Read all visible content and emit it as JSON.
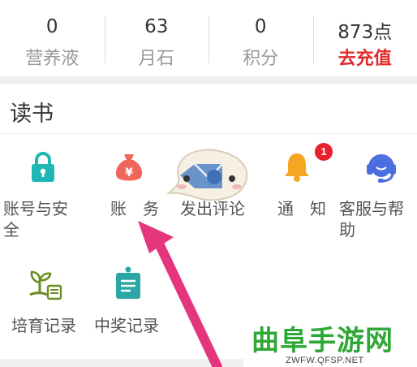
{
  "stats": [
    {
      "value": "0",
      "label": "营养液"
    },
    {
      "value": "63",
      "label": "月石"
    },
    {
      "value": "0",
      "label": "积分"
    },
    {
      "value": "873点",
      "label": "去充值"
    }
  ],
  "reading": {
    "title": "读书",
    "items": [
      {
        "label": "账号与安全",
        "icon": "lock-icon"
      },
      {
        "label": "账　务",
        "icon": "money-bag-icon"
      },
      {
        "label": "发出评论",
        "icon": "comment-icon"
      },
      {
        "label": "通　知",
        "icon": "bell-icon",
        "badge": "1"
      },
      {
        "label": "客服与帮助",
        "icon": "headset-icon"
      },
      {
        "label": "培育记录",
        "icon": "sprout-icon"
      },
      {
        "label": "中奖记录",
        "icon": "badge-icon"
      }
    ]
  },
  "watermark": {
    "name": "曲阜手游网",
    "url": "ZWFW.QFSP.NET"
  },
  "colors": {
    "teal": "#1fb7b4",
    "coral": "#f0665a",
    "orange": "#f5a623",
    "blue": "#4a6ee0",
    "arrow": "#e5357d",
    "accent": "#e02b2b"
  }
}
